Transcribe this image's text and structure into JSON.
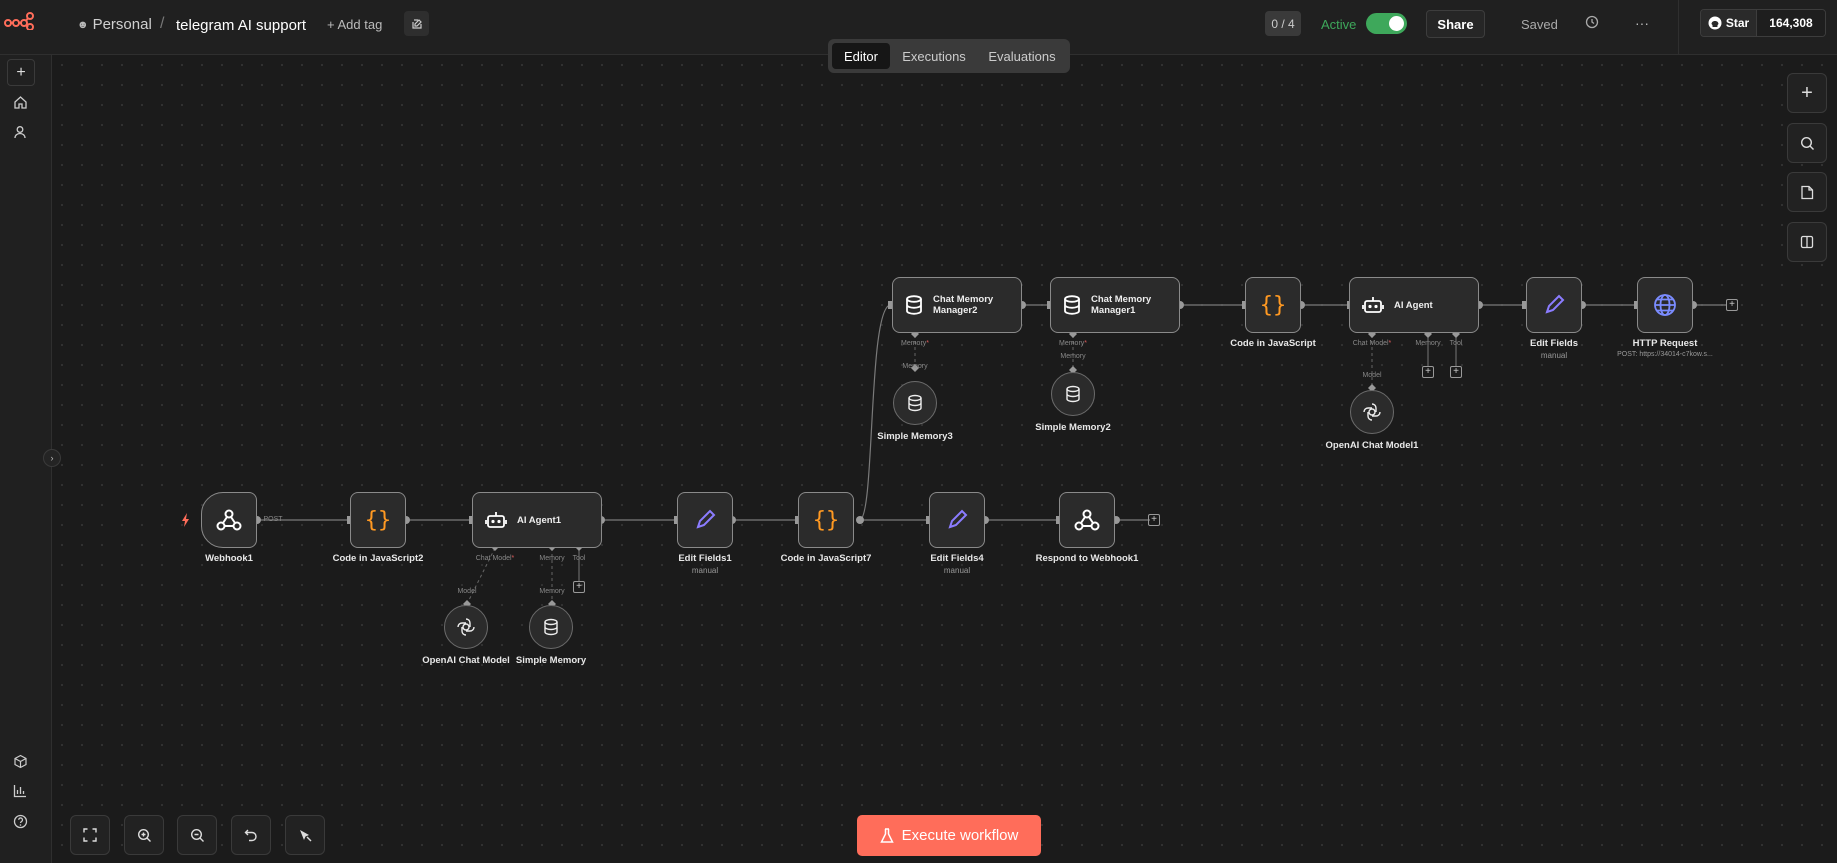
{
  "header": {
    "project": "Personal",
    "separator": "/",
    "workflow_name": "telegram AI support",
    "add_tag": "+ Add tag",
    "counter": "0 / 4",
    "active_label": "Active",
    "share_label": "Share",
    "saved_label": "Saved",
    "more_label": "···",
    "star_label": "Star",
    "star_count": "164,308"
  },
  "tabs": [
    {
      "label": "Editor",
      "active": true
    },
    {
      "label": "Executions",
      "active": false
    },
    {
      "label": "Evaluations",
      "active": false
    }
  ],
  "execute_label": "Execute workflow",
  "colors": {
    "accent": "#ff6d5a",
    "active_green": "#3ea85b",
    "code_orange": "#ff9922",
    "edit_purple": "#8b7cff",
    "http_blue": "#7b8cff"
  },
  "nodes": {
    "webhook1": {
      "label": "Webhook1",
      "port": "POST"
    },
    "code2": {
      "label": "Code in JavaScript2"
    },
    "agent1": {
      "label": "AI Agent1",
      "p_model": "Chat Model",
      "p_memory": "Memory",
      "p_tool": "Tool"
    },
    "openai_model": {
      "label": "OpenAI Chat Model",
      "port": "Model"
    },
    "simple_memory": {
      "label": "Simple Memory",
      "port": "Memory"
    },
    "edit1": {
      "label": "Edit Fields1",
      "sub": "manual"
    },
    "code7": {
      "label": "Code in JavaScript7"
    },
    "edit4": {
      "label": "Edit Fields4",
      "sub": "manual"
    },
    "respond1": {
      "label": "Respond to Webhook1"
    },
    "cmm2": {
      "line1": "Chat Memory",
      "line2": "Manager2",
      "port": "Memory"
    },
    "simple_memory3": {
      "label": "Simple Memory3",
      "port": "Memory"
    },
    "cmm1": {
      "line1": "Chat Memory",
      "line2": "Manager1",
      "port": "Memory"
    },
    "simple_memory2": {
      "label": "Simple Memory2"
    },
    "code_js": {
      "label": "Code in JavaScript"
    },
    "agent": {
      "label": "AI Agent",
      "p_model": "Chat Model",
      "p_memory": "Memory",
      "p_tool": "Tool"
    },
    "openai_model1": {
      "label": "OpenAI Chat Model1",
      "port": "Model"
    },
    "edit_fields": {
      "label": "Edit Fields",
      "sub": "manual"
    },
    "http": {
      "label": "HTTP Request",
      "sub": "POST: https://34014-c7kow.s..."
    }
  }
}
